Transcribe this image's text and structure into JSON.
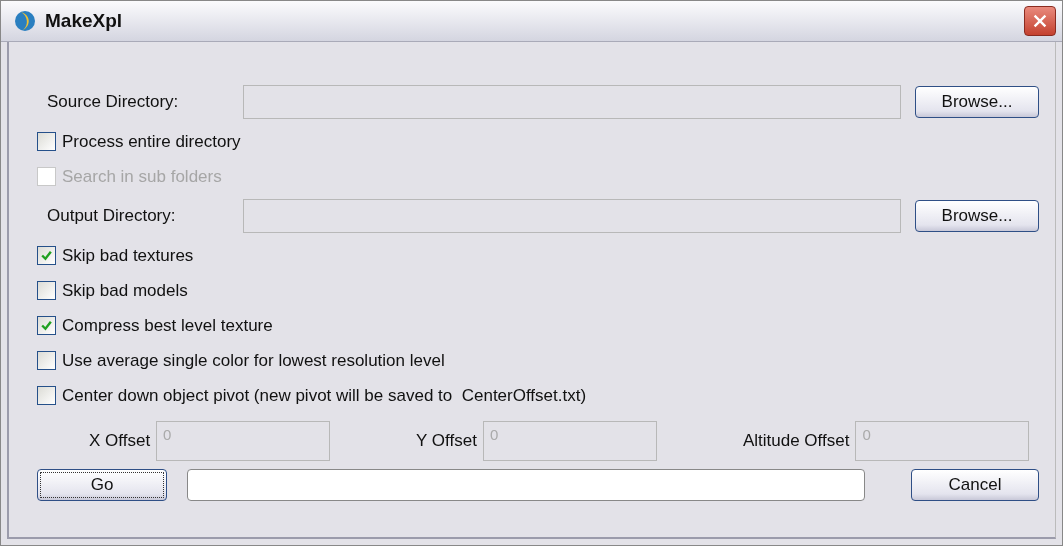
{
  "window": {
    "title": "MakeXpl"
  },
  "rows": [
    {
      "kind": "folder",
      "label": "Source Directory:",
      "button": "Browse..."
    },
    {
      "kind": "checkbox",
      "label": "Process entire directory",
      "checked": false,
      "disabled": false
    },
    {
      "kind": "checkbox",
      "label": "Search in sub folders",
      "checked": false,
      "disabled": true
    },
    {
      "kind": "folder",
      "label": "Output Directory:",
      "button": "Browse..."
    },
    {
      "kind": "checkbox",
      "label": "Skip bad textures",
      "checked": true,
      "disabled": false
    },
    {
      "kind": "checkbox",
      "label": "Skip bad models",
      "checked": false,
      "disabled": false
    },
    {
      "kind": "checkbox",
      "label": "Compress best level texture",
      "checked": true,
      "disabled": false
    },
    {
      "kind": "checkbox",
      "label": "Use average single color for lowest resolution level",
      "checked": false,
      "disabled": false
    },
    {
      "kind": "checkbox",
      "label": "Center down object pivot (new pivot will be saved to  CenterOffset.txt)",
      "checked": false,
      "disabled": false
    }
  ],
  "offsets": [
    {
      "label": "X Offset",
      "value": "0"
    },
    {
      "label": "Y Offset",
      "value": "0"
    },
    {
      "label": "Altitude Offset",
      "value": "0"
    }
  ],
  "go_button": "Go",
  "cancel_button": "Cancel"
}
